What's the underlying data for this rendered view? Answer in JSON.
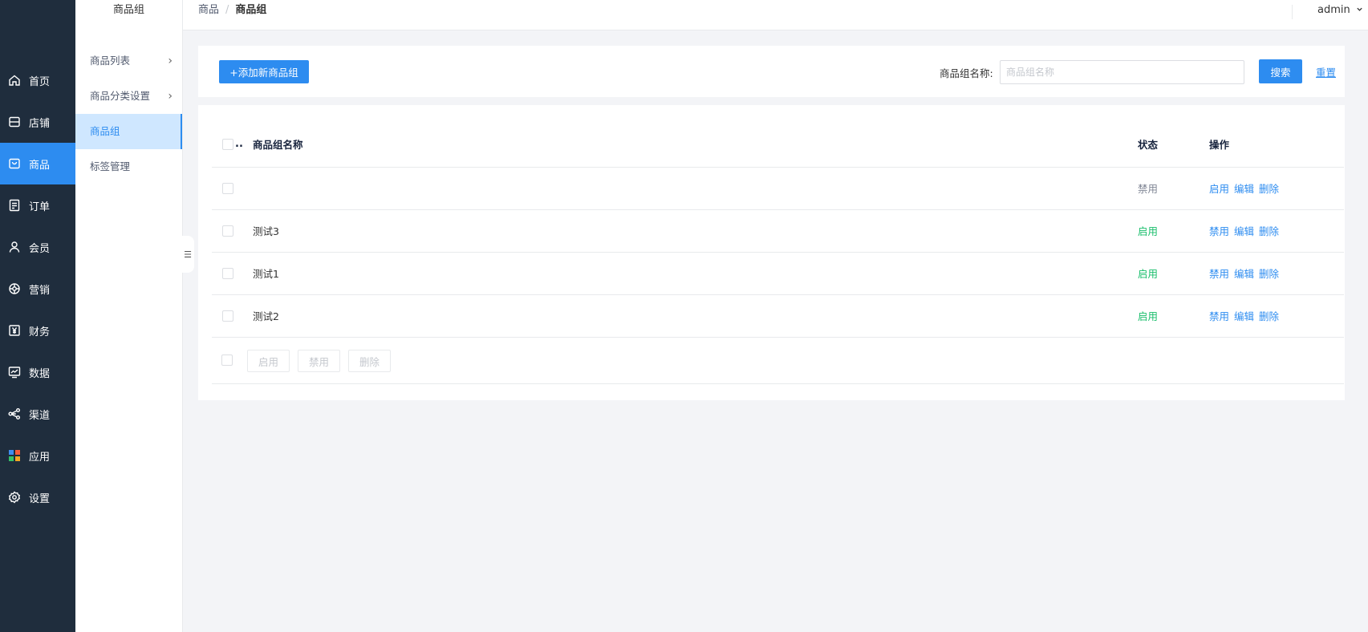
{
  "nav": {
    "items": [
      {
        "label": "首页",
        "icon": "home-icon"
      },
      {
        "label": "店铺",
        "icon": "store-icon"
      },
      {
        "label": "商品",
        "icon": "shopping-bag-icon",
        "active": true
      },
      {
        "label": "订单",
        "icon": "order-document-icon"
      },
      {
        "label": "会员",
        "icon": "user-icon"
      },
      {
        "label": "营销",
        "icon": "marketing-icon"
      },
      {
        "label": "财务",
        "icon": "yuan-icon"
      },
      {
        "label": "数据",
        "icon": "monitor-chart-icon"
      },
      {
        "label": "渠道",
        "icon": "share-channel-icon"
      },
      {
        "label": "应用",
        "icon": "apps-grid-icon"
      },
      {
        "label": "设置",
        "icon": "gear-icon"
      }
    ]
  },
  "submenu": {
    "title": "商品组",
    "items": [
      {
        "label": "商品列表",
        "has_children": true
      },
      {
        "label": "商品分类设置",
        "has_children": true
      },
      {
        "label": "商品组",
        "active": true
      },
      {
        "label": "标签管理"
      }
    ]
  },
  "header": {
    "breadcrumb": {
      "first": "商品",
      "separator": "/",
      "current": "商品组"
    },
    "user": "admin"
  },
  "search": {
    "add_label": "+添加新商品组",
    "field_label": "商品组名称:",
    "placeholder": "商品组名称",
    "search_label": "搜索",
    "reset_label": "重置"
  },
  "table": {
    "header_dots": "..",
    "columns": {
      "name": "商品组名称",
      "status": "状态",
      "ops": "操作"
    },
    "rows": [
      {
        "name": "",
        "status": "禁用",
        "status_kind": "off",
        "ops": [
          "启用",
          "编辑",
          "删除"
        ]
      },
      {
        "name": "测试3",
        "status": "启用",
        "status_kind": "on",
        "ops": [
          "禁用",
          "编辑",
          "删除"
        ]
      },
      {
        "name": "测试1",
        "status": "启用",
        "status_kind": "on",
        "ops": [
          "禁用",
          "编辑",
          "删除"
        ]
      },
      {
        "name": "测试2",
        "status": "启用",
        "status_kind": "on",
        "ops": [
          "禁用",
          "编辑",
          "删除"
        ]
      }
    ],
    "batch": {
      "enable": "启用",
      "disable": "禁用",
      "delete": "删除"
    }
  },
  "colors": {
    "nav_bg": "#1f2d3d",
    "primary": "#2d8cf0",
    "status_on": "#19be6b",
    "status_off": "#808695",
    "submenu_active_bg": "#cfe7ff"
  }
}
